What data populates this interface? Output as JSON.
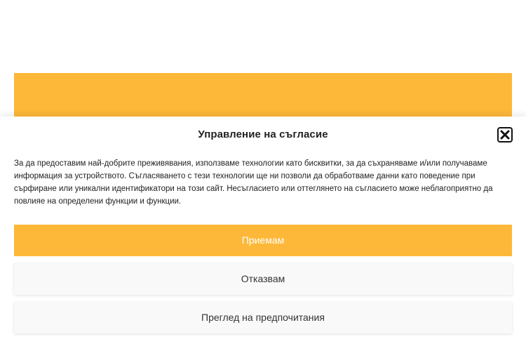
{
  "colors": {
    "accent": "#fdb839",
    "secondary_button_bg": "#f9f9f9",
    "text": "#222222"
  },
  "consent": {
    "title": "Управление на съгласие",
    "close_icon": "close-x-icon",
    "message": "За да предоставим най-добрите преживявания, използваме технологии като бисквитки, за да съхраняваме и/или получаваме информация за устройството. Съгласяването с тези технологии ще ни позволи да обработваме данни като поведение при сърфиране или уникални идентификатори на този сайт. Несъгласието или оттеглянето на съгласието може неблагоприятно да повлияе на определени функции и функции.",
    "accept_label": "Приемам",
    "deny_label": "Отказвам",
    "preferences_label": "Преглед на предпочитания"
  }
}
